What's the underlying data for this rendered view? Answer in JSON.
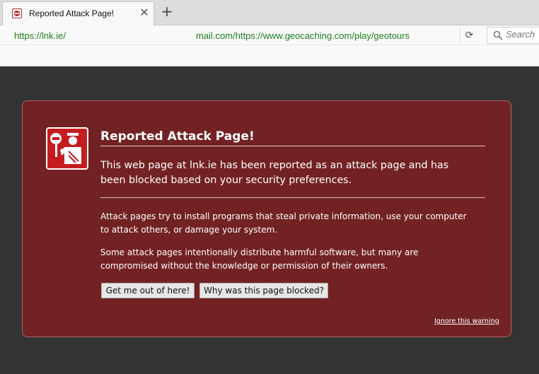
{
  "tab": {
    "title": "Reported Attack Page!",
    "close_glyph": "✕",
    "favicon": "blocked-site-icon"
  },
  "new_tab_glyph": "+",
  "navbar": {
    "url_part1": "https://lnk.ie/",
    "url_part2": "mail.com/https://www.geocaching.com/play/geotours",
    "reload_glyph": "⟳",
    "search_placeholder": "Search",
    "url_color": "#1a7f1a"
  },
  "page": {
    "title": "Reported Attack Page!",
    "lead": "This web page at lnk.ie has been reported as an attack page and has been blocked based on your security preferences.",
    "para1": "Attack pages try to install programs that steal private information, use your computer to attack others, or damage your system.",
    "para2": "Some attack pages intentionally distribute harmful software, but many are compromised without the knowledge or permission of their owners.",
    "button_out": "Get me out of here!",
    "button_why": "Why was this page blocked?",
    "ignore_link": "Ignore this warning",
    "icon": "security-guard-icon"
  },
  "colors": {
    "panel_bg": "#722222",
    "page_bg": "#333333",
    "badge_red": "#c41d20"
  }
}
